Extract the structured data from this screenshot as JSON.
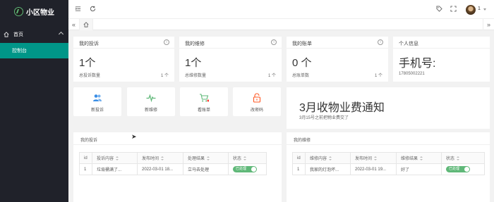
{
  "app": {
    "title": "小区物业"
  },
  "sidebar": {
    "group_label": "首页",
    "items": [
      {
        "label": "控制台"
      }
    ]
  },
  "header": {
    "user_label": "1"
  },
  "stats": [
    {
      "title": "我的投诉",
      "value": "1个",
      "sub_label": "总投诉数量",
      "sub_value": "1 个"
    },
    {
      "title": "我的维修",
      "value": "1个",
      "sub_label": "总维修数量",
      "sub_value": "1 个"
    },
    {
      "title": "我的账单",
      "value": "0 个",
      "sub_label": "总账单数",
      "sub_value": "1 个"
    },
    {
      "title": "个人信息",
      "value": "手机号:",
      "sub_label": "17805002221"
    }
  ],
  "quick_actions": [
    {
      "label": "新投诉",
      "icon": "users-icon",
      "color": "#3a8ee6"
    },
    {
      "label": "新维修",
      "icon": "pulse-icon",
      "color": "#5fb878"
    },
    {
      "label": "看账单",
      "icon": "cart-icon",
      "color": "#5fb878"
    },
    {
      "label": "改密码",
      "icon": "lock-icon",
      "color": "#ff5722"
    }
  ],
  "notice": {
    "title": "3月收物业费通知",
    "text": "3月15号之前把物业费交了"
  },
  "complaints": {
    "title": "我的投诉",
    "columns": [
      "id",
      "投诉内容",
      "发布时间",
      "处理结果",
      "状态"
    ],
    "rows": [
      [
        "1",
        "垃圾桶满了...",
        "2022-03-01 18...",
        "立马去处理",
        "已处理"
      ]
    ]
  },
  "repairs": {
    "title": "我的维修",
    "columns": [
      "id",
      "维修内容",
      "发布时间",
      "维修结果",
      "状态"
    ],
    "rows": [
      [
        "1",
        "我家的灯泡坏...",
        "2022-03-01 19...",
        "好了",
        "已处理"
      ]
    ]
  }
}
